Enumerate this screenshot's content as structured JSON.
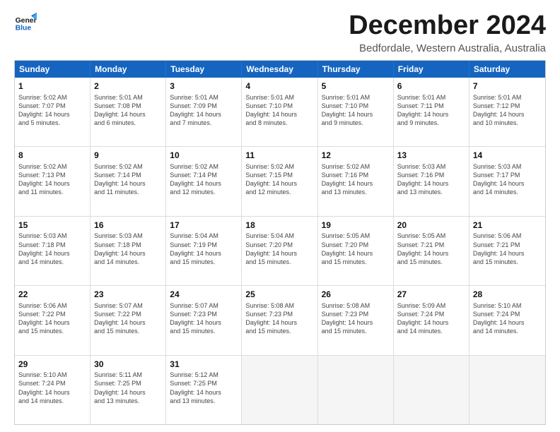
{
  "logo": {
    "line1": "General",
    "line2": "Blue"
  },
  "title": "December 2024",
  "subtitle": "Bedfordale, Western Australia, Australia",
  "header_days": [
    "Sunday",
    "Monday",
    "Tuesday",
    "Wednesday",
    "Thursday",
    "Friday",
    "Saturday"
  ],
  "rows": [
    [
      {
        "day": "1",
        "lines": [
          "Sunrise: 5:02 AM",
          "Sunset: 7:07 PM",
          "Daylight: 14 hours",
          "and 5 minutes."
        ]
      },
      {
        "day": "2",
        "lines": [
          "Sunrise: 5:01 AM",
          "Sunset: 7:08 PM",
          "Daylight: 14 hours",
          "and 6 minutes."
        ]
      },
      {
        "day": "3",
        "lines": [
          "Sunrise: 5:01 AM",
          "Sunset: 7:09 PM",
          "Daylight: 14 hours",
          "and 7 minutes."
        ]
      },
      {
        "day": "4",
        "lines": [
          "Sunrise: 5:01 AM",
          "Sunset: 7:10 PM",
          "Daylight: 14 hours",
          "and 8 minutes."
        ]
      },
      {
        "day": "5",
        "lines": [
          "Sunrise: 5:01 AM",
          "Sunset: 7:10 PM",
          "Daylight: 14 hours",
          "and 9 minutes."
        ]
      },
      {
        "day": "6",
        "lines": [
          "Sunrise: 5:01 AM",
          "Sunset: 7:11 PM",
          "Daylight: 14 hours",
          "and 9 minutes."
        ]
      },
      {
        "day": "7",
        "lines": [
          "Sunrise: 5:01 AM",
          "Sunset: 7:12 PM",
          "Daylight: 14 hours",
          "and 10 minutes."
        ]
      }
    ],
    [
      {
        "day": "8",
        "lines": [
          "Sunrise: 5:02 AM",
          "Sunset: 7:13 PM",
          "Daylight: 14 hours",
          "and 11 minutes."
        ]
      },
      {
        "day": "9",
        "lines": [
          "Sunrise: 5:02 AM",
          "Sunset: 7:14 PM",
          "Daylight: 14 hours",
          "and 11 minutes."
        ]
      },
      {
        "day": "10",
        "lines": [
          "Sunrise: 5:02 AM",
          "Sunset: 7:14 PM",
          "Daylight: 14 hours",
          "and 12 minutes."
        ]
      },
      {
        "day": "11",
        "lines": [
          "Sunrise: 5:02 AM",
          "Sunset: 7:15 PM",
          "Daylight: 14 hours",
          "and 12 minutes."
        ]
      },
      {
        "day": "12",
        "lines": [
          "Sunrise: 5:02 AM",
          "Sunset: 7:16 PM",
          "Daylight: 14 hours",
          "and 13 minutes."
        ]
      },
      {
        "day": "13",
        "lines": [
          "Sunrise: 5:03 AM",
          "Sunset: 7:16 PM",
          "Daylight: 14 hours",
          "and 13 minutes."
        ]
      },
      {
        "day": "14",
        "lines": [
          "Sunrise: 5:03 AM",
          "Sunset: 7:17 PM",
          "Daylight: 14 hours",
          "and 14 minutes."
        ]
      }
    ],
    [
      {
        "day": "15",
        "lines": [
          "Sunrise: 5:03 AM",
          "Sunset: 7:18 PM",
          "Daylight: 14 hours",
          "and 14 minutes."
        ]
      },
      {
        "day": "16",
        "lines": [
          "Sunrise: 5:03 AM",
          "Sunset: 7:18 PM",
          "Daylight: 14 hours",
          "and 14 minutes."
        ]
      },
      {
        "day": "17",
        "lines": [
          "Sunrise: 5:04 AM",
          "Sunset: 7:19 PM",
          "Daylight: 14 hours",
          "and 15 minutes."
        ]
      },
      {
        "day": "18",
        "lines": [
          "Sunrise: 5:04 AM",
          "Sunset: 7:20 PM",
          "Daylight: 14 hours",
          "and 15 minutes."
        ]
      },
      {
        "day": "19",
        "lines": [
          "Sunrise: 5:05 AM",
          "Sunset: 7:20 PM",
          "Daylight: 14 hours",
          "and 15 minutes."
        ]
      },
      {
        "day": "20",
        "lines": [
          "Sunrise: 5:05 AM",
          "Sunset: 7:21 PM",
          "Daylight: 14 hours",
          "and 15 minutes."
        ]
      },
      {
        "day": "21",
        "lines": [
          "Sunrise: 5:06 AM",
          "Sunset: 7:21 PM",
          "Daylight: 14 hours",
          "and 15 minutes."
        ]
      }
    ],
    [
      {
        "day": "22",
        "lines": [
          "Sunrise: 5:06 AM",
          "Sunset: 7:22 PM",
          "Daylight: 14 hours",
          "and 15 minutes."
        ]
      },
      {
        "day": "23",
        "lines": [
          "Sunrise: 5:07 AM",
          "Sunset: 7:22 PM",
          "Daylight: 14 hours",
          "and 15 minutes."
        ]
      },
      {
        "day": "24",
        "lines": [
          "Sunrise: 5:07 AM",
          "Sunset: 7:23 PM",
          "Daylight: 14 hours",
          "and 15 minutes."
        ]
      },
      {
        "day": "25",
        "lines": [
          "Sunrise: 5:08 AM",
          "Sunset: 7:23 PM",
          "Daylight: 14 hours",
          "and 15 minutes."
        ]
      },
      {
        "day": "26",
        "lines": [
          "Sunrise: 5:08 AM",
          "Sunset: 7:23 PM",
          "Daylight: 14 hours",
          "and 15 minutes."
        ]
      },
      {
        "day": "27",
        "lines": [
          "Sunrise: 5:09 AM",
          "Sunset: 7:24 PM",
          "Daylight: 14 hours",
          "and 14 minutes."
        ]
      },
      {
        "day": "28",
        "lines": [
          "Sunrise: 5:10 AM",
          "Sunset: 7:24 PM",
          "Daylight: 14 hours",
          "and 14 minutes."
        ]
      }
    ],
    [
      {
        "day": "29",
        "lines": [
          "Sunrise: 5:10 AM",
          "Sunset: 7:24 PM",
          "Daylight: 14 hours",
          "and 14 minutes."
        ]
      },
      {
        "day": "30",
        "lines": [
          "Sunrise: 5:11 AM",
          "Sunset: 7:25 PM",
          "Daylight: 14 hours",
          "and 13 minutes."
        ]
      },
      {
        "day": "31",
        "lines": [
          "Sunrise: 5:12 AM",
          "Sunset: 7:25 PM",
          "Daylight: 14 hours",
          "and 13 minutes."
        ]
      },
      {
        "day": "",
        "lines": []
      },
      {
        "day": "",
        "lines": []
      },
      {
        "day": "",
        "lines": []
      },
      {
        "day": "",
        "lines": []
      }
    ]
  ]
}
